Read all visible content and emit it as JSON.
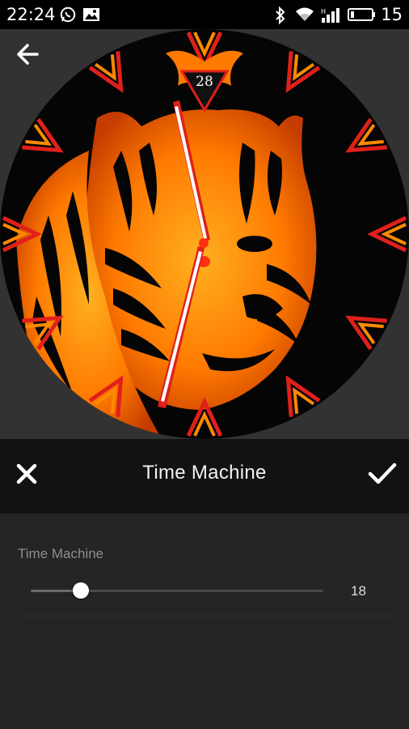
{
  "status_bar": {
    "time": "22:24",
    "battery_level": "15",
    "left_icons": [
      "whatsapp-icon",
      "image-icon"
    ],
    "right_icons": [
      "bluetooth-icon",
      "wifi-icon",
      "signal-icon",
      "battery-icon"
    ]
  },
  "preview": {
    "back_icon": "arrow-left-icon",
    "watch_face": {
      "date": "28",
      "accent_color": "#ff6a00",
      "marker_color": "#e0201a"
    }
  },
  "toolbar": {
    "title": "Time Machine",
    "close_icon": "close-icon",
    "confirm_icon": "check-icon"
  },
  "setting": {
    "label": "Time Machine",
    "value": "18",
    "fraction": 0.17
  },
  "colors": {
    "status_bar_bg": "#000000",
    "preview_bg": "#323232",
    "toolbar_bg": "#121212",
    "settings_bg": "#252525"
  }
}
